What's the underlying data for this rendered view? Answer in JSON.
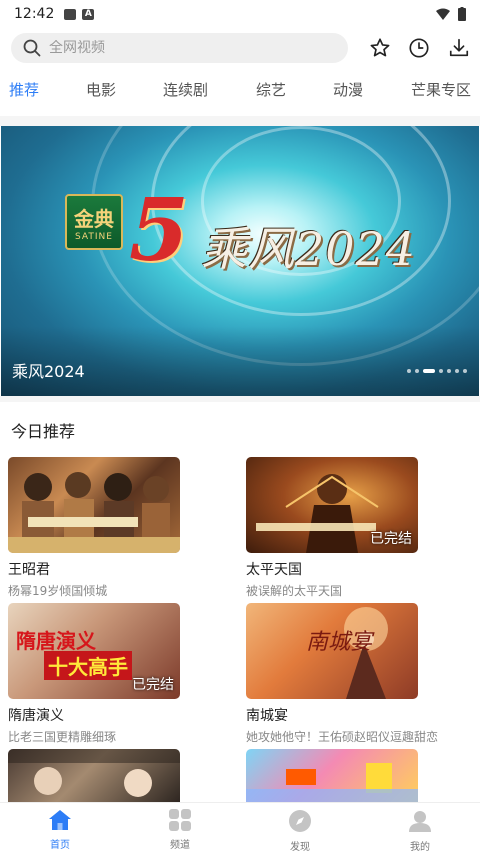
{
  "status_bar": {
    "time": "12:42"
  },
  "search": {
    "placeholder": "全网视频"
  },
  "tabs": [
    {
      "label": "推荐",
      "active": true
    },
    {
      "label": "电影"
    },
    {
      "label": "连续剧"
    },
    {
      "label": "综艺"
    },
    {
      "label": "动漫"
    },
    {
      "label": "芒果专区"
    }
  ],
  "banner": {
    "title": "乘风2024",
    "logo_text": "金典",
    "logo_subtext": "SATINE",
    "number_text": "5",
    "big_text": "乘风2024",
    "dot_count": 7,
    "active_dot": 2
  },
  "section": {
    "title": "今日推荐"
  },
  "cards": [
    {
      "title": "王昭君",
      "subtitle": "杨幂19岁倾国倾城",
      "badge": ""
    },
    {
      "title": "太平天国",
      "subtitle": "被误解的太平天国",
      "badge": "已完结"
    },
    {
      "title": "隋唐演义",
      "subtitle": "比老三国更精雕细琢",
      "badge": "已完结",
      "thumb_line1": "隋唐演义",
      "thumb_line2": "十大高手"
    },
    {
      "title": "南城宴",
      "subtitle": "她攻她他守！王佑硕赵昭仪逗趣甜恋",
      "badge": ""
    }
  ],
  "bottom_nav": [
    {
      "label": "首页",
      "icon": "home-icon",
      "active": true
    },
    {
      "label": "频道",
      "icon": "grid-icon"
    },
    {
      "label": "发现",
      "icon": "compass-icon"
    },
    {
      "label": "我的",
      "icon": "user-icon"
    }
  ],
  "colors": {
    "accent": "#2d7df6",
    "text": "#222222",
    "subtext": "#888888"
  }
}
